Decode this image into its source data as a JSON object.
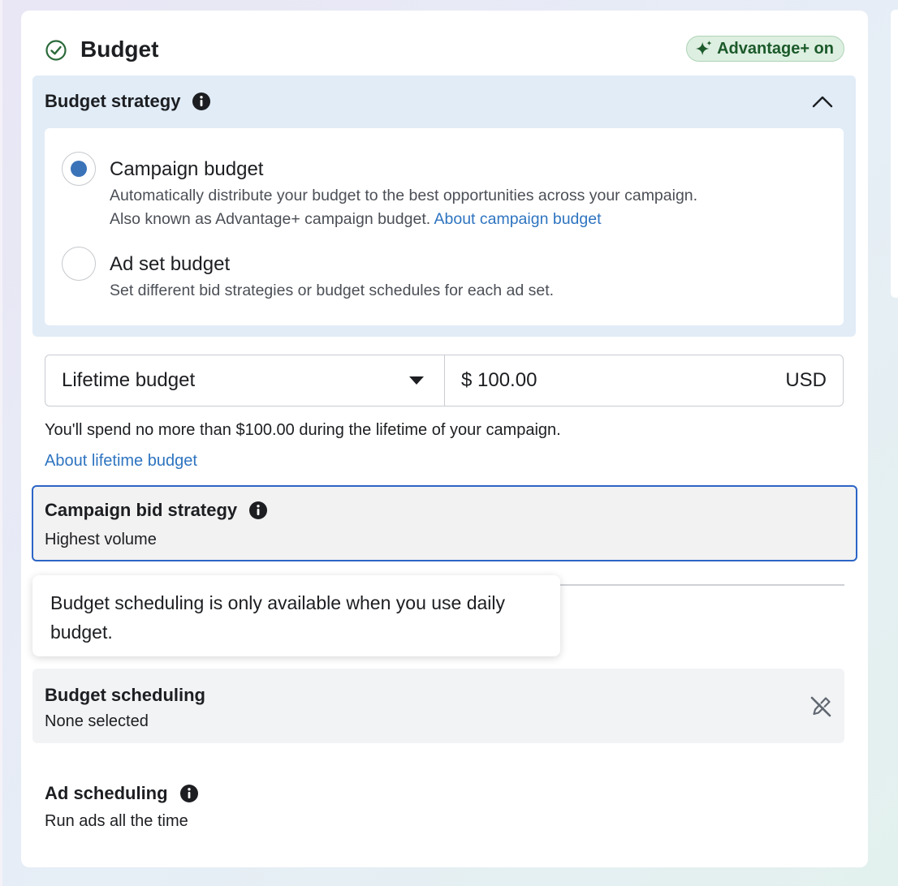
{
  "header": {
    "title": "Budget",
    "badge_label": "Advantage+ on",
    "check_icon": "check-circle-icon",
    "sparkle_icon": "sparkle-icon"
  },
  "budget_strategy": {
    "title": "Budget strategy",
    "info_icon": "info-icon",
    "collapse_icon": "chevron-up-icon",
    "options": [
      {
        "title": "Campaign budget",
        "selected": true,
        "desc_line1": "Automatically distribute your budget to the best opportunities across your campaign.",
        "desc_line2": "Also known as Advantage+ campaign budget.",
        "link": "About campaign budget"
      },
      {
        "title": "Ad set budget",
        "selected": false,
        "desc_line1": "Set different bid strategies or budget schedules for each ad set."
      }
    ]
  },
  "budget": {
    "type": "Lifetime budget",
    "amount": "$ 100.00",
    "currency": "USD",
    "note": "You'll spend no more than $100.00 during the lifetime of your campaign.",
    "link": "About lifetime budget"
  },
  "bid_strategy": {
    "title": "Campaign bid strategy",
    "value": "Highest volume"
  },
  "tooltip": {
    "text": "Budget scheduling is only available when you use daily budget."
  },
  "budget_scheduling": {
    "title": "Budget scheduling",
    "value": "None selected",
    "edit_icon": "pencil-disabled-icon"
  },
  "ad_scheduling": {
    "title": "Ad scheduling",
    "value": "Run ads all the time"
  },
  "colors": {
    "accent_blue": "#3b73b9",
    "link_blue": "#2e74c0",
    "focus_border": "#2c64c6",
    "advantage_green": "#1c5a2a",
    "strategy_bg": "#e1ecf7"
  }
}
